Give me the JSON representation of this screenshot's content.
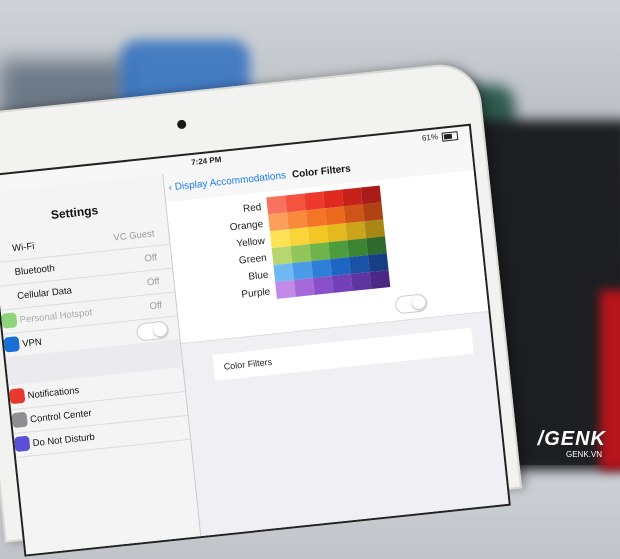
{
  "status": {
    "time": "7:24 PM",
    "battery": "61%"
  },
  "sidebar": {
    "title": "Settings",
    "items": [
      {
        "label": "Wi-Fi",
        "value": "VC Guest"
      },
      {
        "label": "Bluetooth",
        "value": "Off"
      },
      {
        "label": "Cellular Data",
        "value": "Off"
      },
      {
        "label": "Personal Hotspot",
        "value": "Off"
      },
      {
        "label": "VPN"
      },
      {
        "label": "Notifications"
      },
      {
        "label": "Control Center"
      },
      {
        "label": "Do Not Disturb"
      }
    ]
  },
  "nav": {
    "back_label": "Display Accommodations",
    "title": "Color Filters"
  },
  "color_labels": [
    "Red",
    "Orange",
    "Yellow",
    "Green",
    "Blue",
    "Purple"
  ],
  "swatch_colors": [
    [
      "#f7735f",
      "#f4533f",
      "#ee3a2c",
      "#e02a1f",
      "#c6221a",
      "#a91d18"
    ],
    [
      "#fba05b",
      "#f98a3c",
      "#f57526",
      "#ec6a1d",
      "#cf5417",
      "#b04214"
    ],
    [
      "#fde256",
      "#f9d43a",
      "#f2c624",
      "#e5b81e",
      "#cca41a",
      "#a98714"
    ],
    [
      "#b6d76f",
      "#93c65a",
      "#6fb34a",
      "#4e9d3c",
      "#3b8434",
      "#2d6a2c"
    ],
    [
      "#6fb9f2",
      "#4b9be6",
      "#2e7fd8",
      "#1f66c2",
      "#1a52a6",
      "#163f85"
    ],
    [
      "#c08ae6",
      "#a56ad9",
      "#8a4fca",
      "#7240b8",
      "#5f33a0",
      "#4b2884"
    ]
  ],
  "filters": {
    "row_label": "Color Filters"
  },
  "watermark": {
    "brand": "/GENK",
    "site": "GENK.VN"
  }
}
